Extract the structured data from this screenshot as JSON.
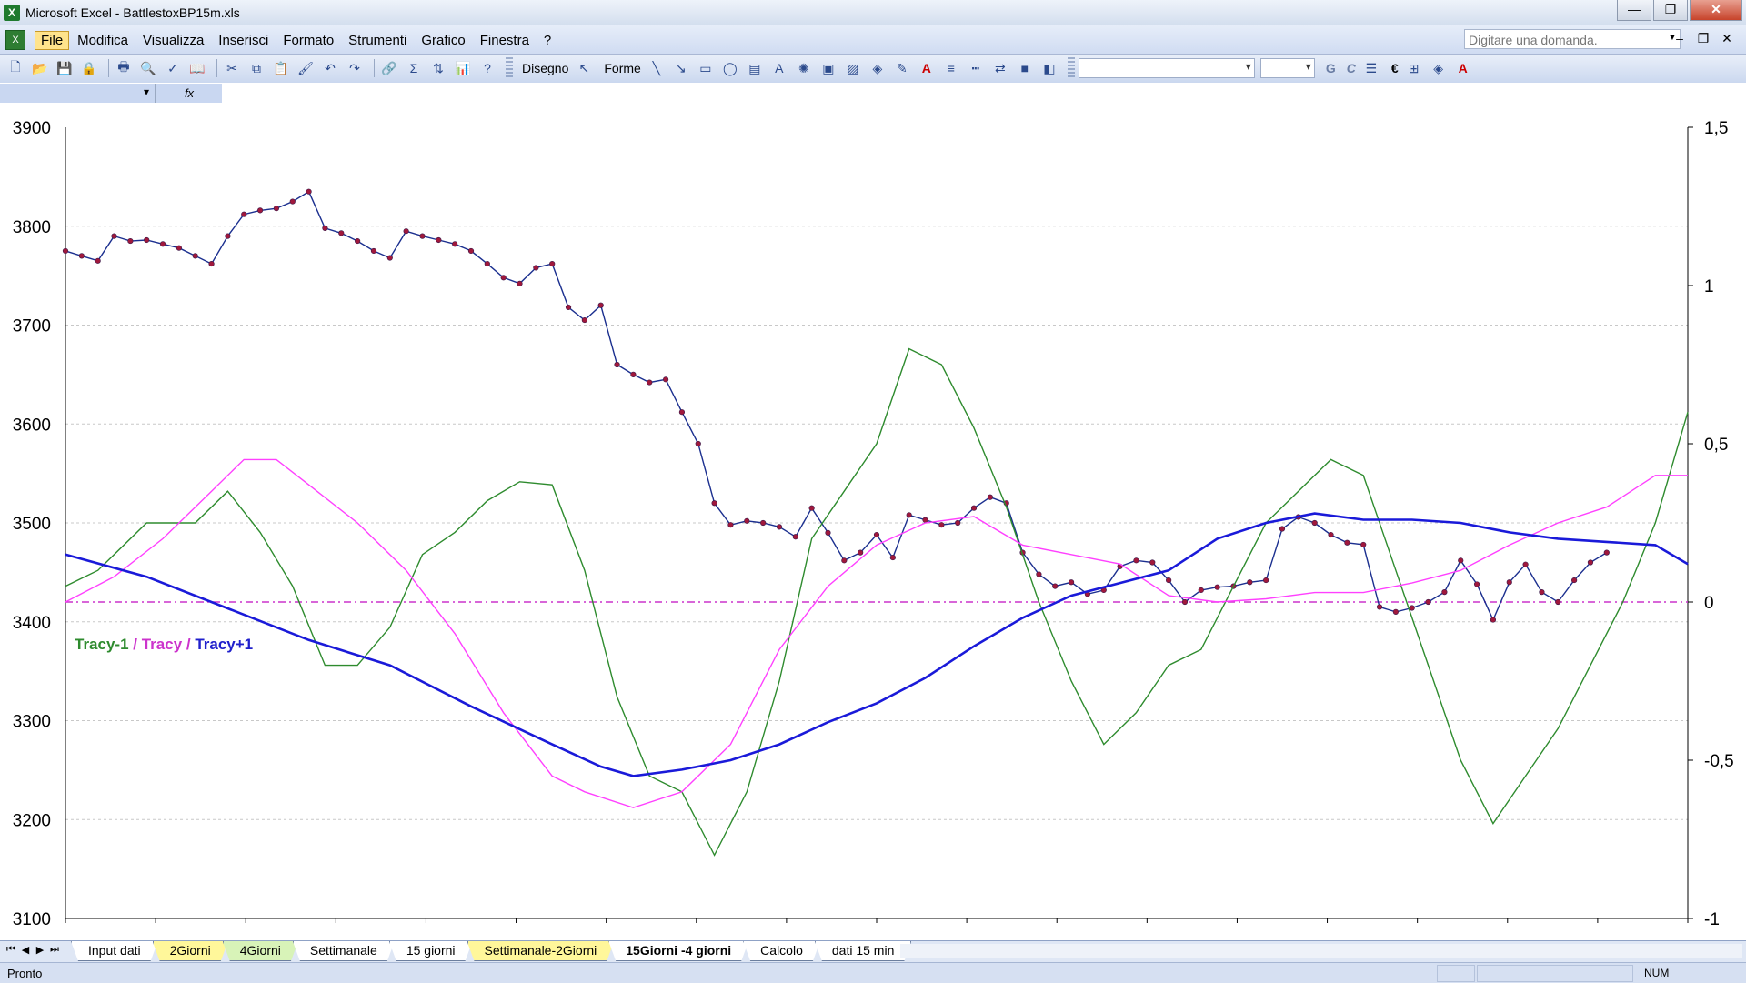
{
  "window": {
    "title": "Microsoft Excel - BattlestoxBP15m.xls",
    "app_icon": "excel-icon"
  },
  "menu": {
    "items": [
      "File",
      "Modifica",
      "Visualizza",
      "Inserisci",
      "Formato",
      "Strumenti",
      "Grafico",
      "Finestra",
      "?"
    ],
    "active": "File",
    "ask_placeholder": "Digitare una domanda."
  },
  "toolbar": {
    "drawing_label": "Disegno",
    "shapes_label": "Forme",
    "bold_label": "G",
    "italic_label": "C",
    "euro_label": "€"
  },
  "sheet_tabs": [
    {
      "label": "Input dati",
      "color": "white"
    },
    {
      "label": "2Giorni",
      "color": "yellow"
    },
    {
      "label": "4Giorni",
      "color": "green"
    },
    {
      "label": "Settimanale",
      "color": "white"
    },
    {
      "label": "15 giorni",
      "color": "white"
    },
    {
      "label": "Settimanale-2Giorni",
      "color": "yellow"
    },
    {
      "label": "15Giorni -4 giorni",
      "color": "active"
    },
    {
      "label": "Calcolo",
      "color": "white"
    },
    {
      "label": "dati 15 min",
      "color": "white"
    }
  ],
  "status": {
    "left": "Pronto",
    "num": "NUM"
  },
  "chart_data": {
    "type": "line",
    "left_axis": {
      "ylim": [
        3100,
        3900
      ],
      "ticks": [
        "3900",
        "3800",
        "3700",
        "3600",
        "3500",
        "3400",
        "3300",
        "3200",
        "3100"
      ]
    },
    "right_axis": {
      "ylim": [
        -1,
        1.5
      ],
      "ticks": [
        "1,5",
        "1",
        "0,5",
        "0",
        "-0,5",
        "-1"
      ]
    },
    "legend": {
      "parts": [
        "Tracy-1",
        " / ",
        "Tracy",
        " / ",
        "Tracy+1"
      ],
      "colors": [
        "#2e8b2e",
        "#cc33cc",
        "#cc33cc",
        "#cc33cc",
        "#2020cc"
      ]
    },
    "x_range": [
      0,
      100
    ],
    "reference_line": {
      "value": 0,
      "axis": "right",
      "color": "#cc33cc"
    },
    "series": [
      {
        "axis": "left",
        "color": "#1b2f8f",
        "marker_color": "#a0183c",
        "markers": true,
        "x": [
          0,
          1,
          2,
          3,
          4,
          5,
          6,
          7,
          8,
          9,
          10,
          11,
          12,
          13,
          14,
          15,
          16,
          17,
          18,
          19,
          20,
          21,
          22,
          23,
          24,
          25,
          26,
          27,
          28,
          29,
          30,
          31,
          32,
          33,
          34,
          35,
          36,
          37,
          38,
          39,
          40,
          41,
          42,
          43,
          44,
          45,
          46,
          47,
          48,
          49,
          50,
          51,
          52,
          53,
          54,
          55,
          56,
          57,
          58,
          59,
          60,
          61,
          62,
          63,
          64,
          65,
          66,
          67,
          68,
          69,
          70,
          71,
          72,
          73,
          74,
          75,
          76,
          77,
          78,
          79,
          80,
          81,
          82,
          83,
          84,
          85,
          86,
          87,
          88,
          89,
          90,
          91,
          92,
          93,
          94,
          95
        ],
        "values": [
          3775,
          3770,
          3765,
          3790,
          3785,
          3786,
          3782,
          3778,
          3770,
          3762,
          3790,
          3812,
          3816,
          3818,
          3825,
          3835,
          3798,
          3793,
          3785,
          3775,
          3768,
          3795,
          3790,
          3786,
          3782,
          3775,
          3762,
          3748,
          3742,
          3758,
          3762,
          3718,
          3705,
          3720,
          3660,
          3650,
          3642,
          3645,
          3612,
          3580,
          3520,
          3498,
          3502,
          3500,
          3496,
          3486,
          3515,
          3490,
          3462,
          3470,
          3488,
          3465,
          3508,
          3503,
          3498,
          3500,
          3515,
          3526,
          3520,
          3470,
          3448,
          3436,
          3440,
          3428,
          3432,
          3456,
          3462,
          3460,
          3442,
          3420,
          3432,
          3435,
          3436,
          3440,
          3442,
          3494,
          3506,
          3500,
          3488,
          3480,
          3478,
          3415,
          3410,
          3414,
          3420,
          3430,
          3462,
          3438,
          3402,
          3440,
          3458,
          3430,
          3420,
          3442,
          3460,
          3470
        ]
      },
      {
        "axis": "right",
        "color": "#2e8b2e",
        "markers": false,
        "x": [
          0,
          2,
          5,
          8,
          10,
          12,
          14,
          16,
          18,
          20,
          22,
          24,
          26,
          28,
          30,
          32,
          34,
          36,
          38,
          40,
          42,
          44,
          46,
          48,
          50,
          52,
          54,
          56,
          58,
          60,
          62,
          64,
          66,
          68,
          70,
          72,
          74,
          76,
          78,
          80,
          82,
          84,
          86,
          88,
          90,
          92,
          94,
          96,
          98,
          100
        ],
        "values": [
          0.05,
          0.1,
          0.25,
          0.25,
          0.35,
          0.22,
          0.05,
          -0.2,
          -0.2,
          -0.08,
          0.15,
          0.22,
          0.32,
          0.38,
          0.37,
          0.1,
          -0.3,
          -0.55,
          -0.6,
          -0.8,
          -0.6,
          -0.25,
          0.2,
          0.35,
          0.5,
          0.8,
          0.75,
          0.55,
          0.3,
          0.0,
          -0.25,
          -0.45,
          -0.35,
          -0.2,
          -0.15,
          0.05,
          0.25,
          0.35,
          0.45,
          0.4,
          0.1,
          -0.2,
          -0.5,
          -0.7,
          -0.55,
          -0.4,
          -0.2,
          0.0,
          0.25,
          0.6
        ]
      },
      {
        "axis": "right",
        "color": "#ff40ff",
        "markers": false,
        "x": [
          0,
          3,
          6,
          9,
          11,
          13,
          15,
          18,
          21,
          24,
          27,
          30,
          32,
          35,
          38,
          41,
          44,
          47,
          50,
          53,
          56,
          59,
          62,
          65,
          68,
          71,
          74,
          77,
          80,
          83,
          86,
          89,
          92,
          95,
          98,
          100
        ],
        "values": [
          0.0,
          0.08,
          0.2,
          0.35,
          0.45,
          0.45,
          0.37,
          0.25,
          0.1,
          -0.1,
          -0.35,
          -0.55,
          -0.6,
          -0.65,
          -0.6,
          -0.45,
          -0.15,
          0.05,
          0.18,
          0.25,
          0.27,
          0.18,
          0.15,
          0.12,
          0.02,
          0.0,
          0.01,
          0.03,
          0.03,
          0.06,
          0.1,
          0.18,
          0.25,
          0.3,
          0.4,
          0.4
        ]
      },
      {
        "axis": "right",
        "color": "#1a1ad9",
        "markers": false,
        "x": [
          0,
          5,
          10,
          15,
          20,
          25,
          30,
          33,
          35,
          38,
          41,
          44,
          47,
          50,
          53,
          56,
          59,
          62,
          65,
          68,
          71,
          74,
          77,
          80,
          83,
          86,
          89,
          92,
          95,
          98,
          100
        ],
        "values": [
          0.15,
          0.08,
          -0.02,
          -0.12,
          -0.2,
          -0.33,
          -0.45,
          -0.52,
          -0.55,
          -0.53,
          -0.5,
          -0.45,
          -0.38,
          -0.32,
          -0.24,
          -0.14,
          -0.05,
          0.02,
          0.06,
          0.1,
          0.2,
          0.25,
          0.28,
          0.26,
          0.26,
          0.25,
          0.22,
          0.2,
          0.19,
          0.18,
          0.12
        ]
      }
    ]
  }
}
